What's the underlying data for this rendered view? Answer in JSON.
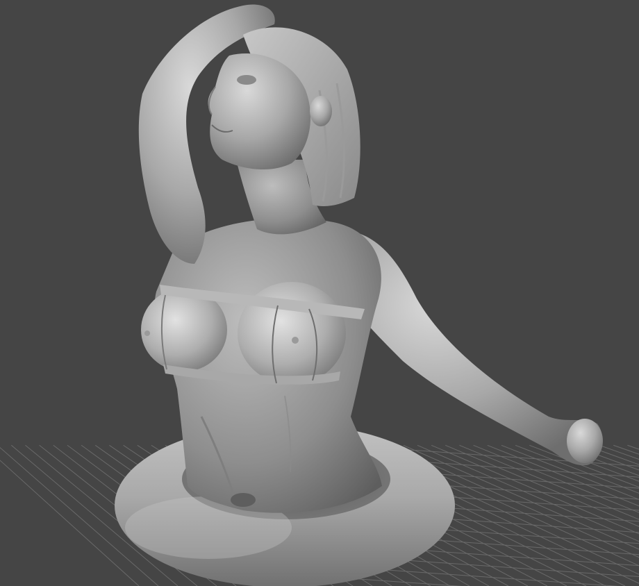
{
  "viewport": {
    "background_color": "#454545",
    "grid_color": "#6a6a6a",
    "model_color": "#9c9c9c",
    "model_highlight_color": "#d6d6d6",
    "model_shadow_color": "#5a5a5a"
  },
  "scene": {
    "objects": [
      {
        "name": "figure-bust",
        "icon": "sculpted-mesh-icon"
      },
      {
        "name": "swim-ring-base",
        "icon": "torus-mesh-icon"
      }
    ],
    "floor_grid_visible": true
  }
}
